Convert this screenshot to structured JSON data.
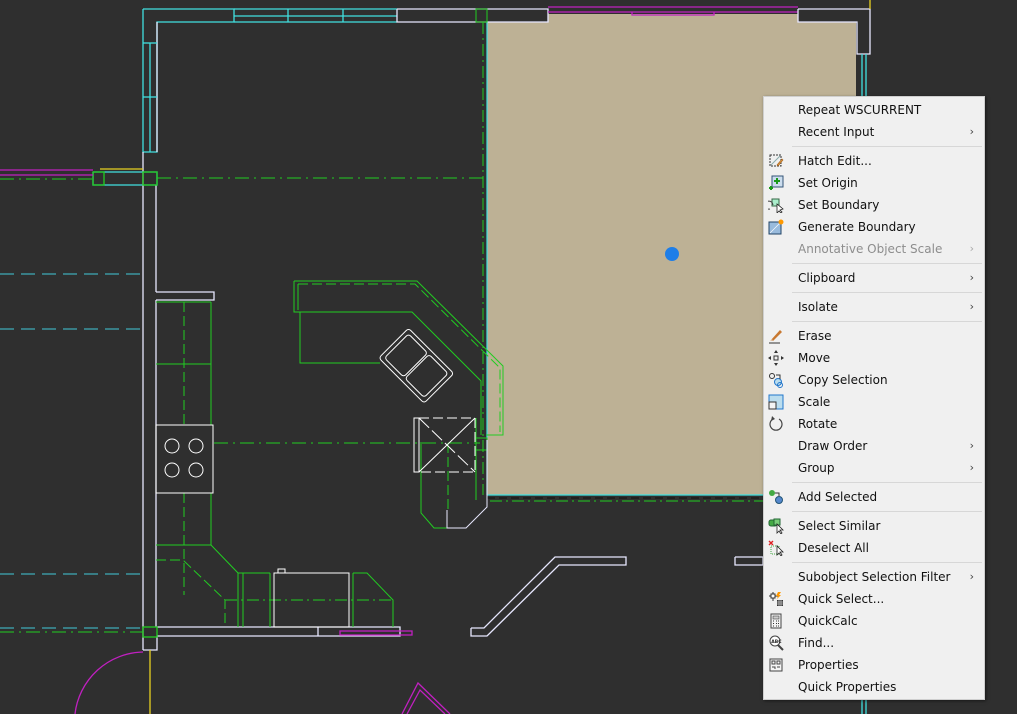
{
  "app": "AutoCAD drawing canvas with context menu",
  "drawing": {
    "background_color": "#2f2f2f",
    "hatch_color": "#bdb195",
    "grip_color": "#1e7ee8",
    "layer_colors": {
      "walls": "#e8e8ff",
      "wall_highlight": "#2222aa",
      "windows": "#40e0e0",
      "cabinets": "#22cc22",
      "fixtures": "#ffffff",
      "doors": "#c020c0",
      "hidden": "#40c8d8",
      "yellow": "#e8d020"
    }
  },
  "context_menu": {
    "items": [
      {
        "label": "Repeat WSCURRENT",
        "icon": "",
        "submenu": false,
        "disabled": false
      },
      {
        "label": "Recent Input",
        "icon": "",
        "submenu": true,
        "disabled": false
      },
      {
        "separator": true
      },
      {
        "label": "Hatch Edit...",
        "icon": "hatch-edit-icon",
        "submenu": false,
        "disabled": false
      },
      {
        "label": "Set Origin",
        "icon": "set-origin-icon",
        "submenu": false,
        "disabled": false
      },
      {
        "label": "Set Boundary",
        "icon": "set-boundary-icon",
        "submenu": false,
        "disabled": false
      },
      {
        "label": "Generate Boundary",
        "icon": "generate-boundary-icon",
        "submenu": false,
        "disabled": false
      },
      {
        "label": "Annotative Object Scale",
        "icon": "",
        "submenu": true,
        "disabled": true
      },
      {
        "separator": true
      },
      {
        "label": "Clipboard",
        "icon": "",
        "submenu": true,
        "disabled": false
      },
      {
        "separator": true
      },
      {
        "label": "Isolate",
        "icon": "",
        "submenu": true,
        "disabled": false
      },
      {
        "separator": true
      },
      {
        "label": "Erase",
        "icon": "erase-icon",
        "submenu": false,
        "disabled": false
      },
      {
        "label": "Move",
        "icon": "move-icon",
        "submenu": false,
        "disabled": false
      },
      {
        "label": "Copy Selection",
        "icon": "copy-selection-icon",
        "submenu": false,
        "disabled": false
      },
      {
        "label": "Scale",
        "icon": "scale-icon",
        "submenu": false,
        "disabled": false
      },
      {
        "label": "Rotate",
        "icon": "rotate-icon",
        "submenu": false,
        "disabled": false
      },
      {
        "label": "Draw Order",
        "icon": "",
        "submenu": true,
        "disabled": false
      },
      {
        "label": "Group",
        "icon": "",
        "submenu": true,
        "disabled": false
      },
      {
        "separator": true
      },
      {
        "label": "Add Selected",
        "icon": "add-selected-icon",
        "submenu": false,
        "disabled": false
      },
      {
        "separator": true
      },
      {
        "label": "Select Similar",
        "icon": "select-similar-icon",
        "submenu": false,
        "disabled": false
      },
      {
        "label": "Deselect All",
        "icon": "deselect-all-icon",
        "submenu": false,
        "disabled": false
      },
      {
        "separator": true
      },
      {
        "label": "Subobject Selection Filter",
        "icon": "",
        "submenu": true,
        "disabled": false
      },
      {
        "label": "Quick Select...",
        "icon": "quick-select-icon",
        "submenu": false,
        "disabled": false
      },
      {
        "label": "QuickCalc",
        "icon": "quickcalc-icon",
        "submenu": false,
        "disabled": false
      },
      {
        "label": "Find...",
        "icon": "find-icon",
        "submenu": false,
        "disabled": false
      },
      {
        "label": "Properties",
        "icon": "properties-icon",
        "submenu": false,
        "disabled": false
      },
      {
        "label": "Quick Properties",
        "icon": "",
        "submenu": false,
        "disabled": false
      }
    ],
    "submenu_arrow": "›"
  }
}
